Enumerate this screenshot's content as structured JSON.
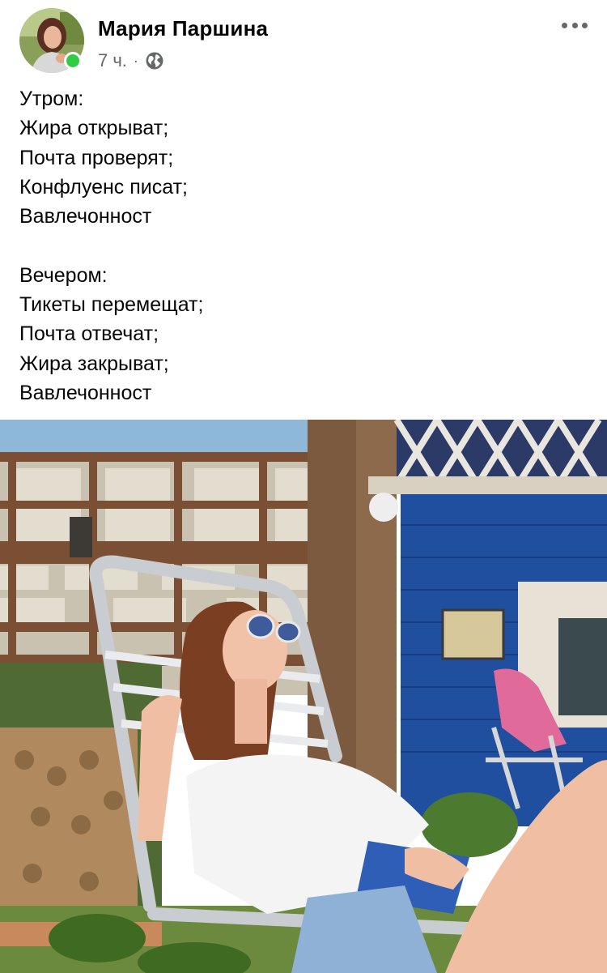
{
  "post": {
    "author": {
      "name": "Мария Паршина",
      "online": true
    },
    "meta": {
      "time": "7 ч.",
      "separator": "·",
      "privacy_icon": "globe-icon"
    },
    "menu_icon": "more-options-icon",
    "text_paragraphs": [
      [
        "Утром:",
        "Жира открыват;",
        "Почта проверят;",
        "Конфлуенс писат;",
        "Вавлечонност"
      ],
      [
        "Вечером:",
        "Тикеты перемещат;",
        "Почта отвечат;",
        "Жира закрыват;",
        "Вавлечонност"
      ]
    ]
  },
  "colors": {
    "text_primary": "#050505",
    "text_secondary": "#65676b",
    "online_green": "#31cc46",
    "house_wall_blue": "#1f4f9e",
    "sky": "#8fb8d8"
  }
}
